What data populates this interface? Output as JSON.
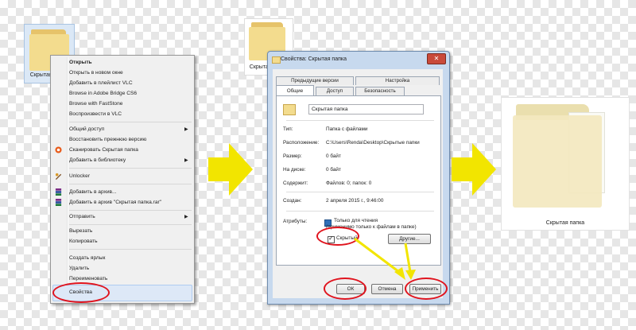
{
  "folder1": {
    "caption": "Скрытая папка"
  },
  "folder2": {
    "caption": "Скрытая папка"
  },
  "folder3": {
    "caption": "Скрытая папка"
  },
  "context_menu": {
    "items": [
      {
        "label": "Открыть",
        "bold": true
      },
      {
        "label": "Открыть в новом окне"
      },
      {
        "label": "Добавить в плейлист VLC"
      },
      {
        "label": "Browse in Adobe Bridge CS6"
      },
      {
        "label": "Browse with FastStone"
      },
      {
        "label": "Воспроизвести в VLC"
      },
      {
        "label": "Общий доступ"
      },
      {
        "label": "Восстановить прежнюю версию"
      },
      {
        "label": "Сканировать Скрытая папка"
      },
      {
        "label": "Добавить в библиотеку"
      },
      {
        "label": "Unlocker"
      },
      {
        "label": "Добавить в архив..."
      },
      {
        "label": "Добавить в архив \"Скрытая папка.rar\""
      },
      {
        "label": "Отправить"
      },
      {
        "label": "Вырезать"
      },
      {
        "label": "Копировать"
      },
      {
        "label": "Создать ярлык"
      },
      {
        "label": "Удалить"
      },
      {
        "label": "Переименовать"
      },
      {
        "label": "Свойства"
      }
    ],
    "submenu_arrow": "▶"
  },
  "dialog": {
    "title": "Свойства: Скрытая папка",
    "close_glyph": "✕",
    "tabs_row1": [
      "Предыдущие версии",
      "Настройка"
    ],
    "tabs_row2": [
      "Общие",
      "Доступ",
      "Безопасность"
    ],
    "name_value": "Скрытая папка",
    "props": [
      {
        "label": "Тип:",
        "value": "Папка с файлами"
      },
      {
        "label": "Расположение:",
        "value": "C:\\Users\\Renda\\Desktop\\Скрытые папки"
      },
      {
        "label": "Размер:",
        "value": "0 байт"
      },
      {
        "label": "На диске:",
        "value": "0 байт"
      },
      {
        "label": "Содержит:",
        "value": "Файлов: 0; папок: 0"
      },
      {
        "label": "Создан:",
        "value": "2 апреля 2015 г., 9:46:00"
      }
    ],
    "attributes_label": "Атрибуты:",
    "readonly_line1": "Только для чтения",
    "readonly_line2": "(применимо только к файлам в папке)",
    "hidden_label": "Скрытый",
    "other_button": "Другие...",
    "ok_button": "ОК",
    "cancel_button": "Отмена",
    "apply_button": "Применить"
  },
  "colors": {
    "highlight_oval": "#e0141e",
    "arrow": "#f2e500"
  }
}
